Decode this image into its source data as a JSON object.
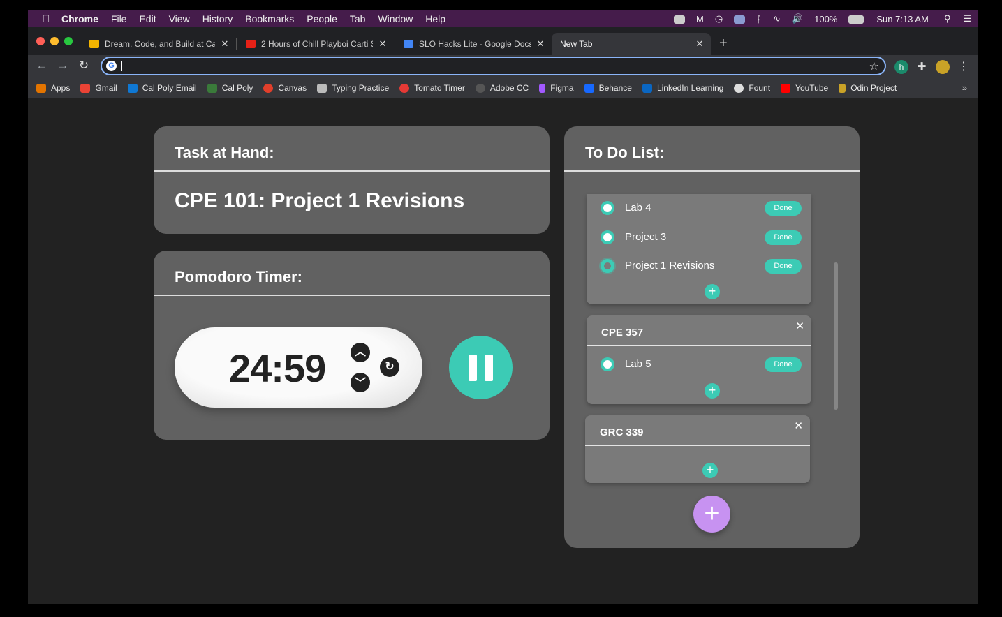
{
  "menubar": {
    "app": "Chrome",
    "items": [
      "File",
      "Edit",
      "View",
      "History",
      "Bookmarks",
      "People",
      "Tab",
      "Window",
      "Help"
    ],
    "battery": "100%",
    "clock": "Sun 7:13 AM"
  },
  "tabs": [
    {
      "title": "Dream, Code, and Build at Cal P",
      "icon_color": "#f4b400"
    },
    {
      "title": "2 Hours of Chill Playboi Carti S",
      "icon_color": "#e62117"
    },
    {
      "title": "SLO Hacks Lite - Google Docs",
      "icon_color": "#4285f4"
    },
    {
      "title": "New Tab",
      "icon_color": ""
    }
  ],
  "omnibox": {
    "value": ""
  },
  "bookmarks": [
    {
      "label": "Apps",
      "color": "#e37400"
    },
    {
      "label": "Gmail",
      "color": "#ea4335"
    },
    {
      "label": "Cal Poly Email",
      "color": "#0f78d4"
    },
    {
      "label": "Cal Poly",
      "color": "#3a7a3a"
    },
    {
      "label": "Canvas",
      "color": "#e13f2b"
    },
    {
      "label": "Typing Practice",
      "color": "#bbbbbb"
    },
    {
      "label": "Tomato Timer",
      "color": "#e53935"
    },
    {
      "label": "Adobe CC",
      "color": "#555555"
    },
    {
      "label": "Figma",
      "color": "#a259ff"
    },
    {
      "label": "Behance",
      "color": "#1769ff"
    },
    {
      "label": "LinkedIn Learning",
      "color": "#0a66c2"
    },
    {
      "label": "Fount",
      "color": "#dddddd"
    },
    {
      "label": "YouTube",
      "color": "#ff0000"
    },
    {
      "label": "Odin Project",
      "color": "#c9a227"
    }
  ],
  "bookmarks_more": "»",
  "task": {
    "heading": "Task at Hand:",
    "title": "CPE 101: Project 1 Revisions"
  },
  "timer": {
    "heading": "Pomodoro Timer:",
    "time": "24:59"
  },
  "todo": {
    "heading": "To Do List:",
    "done_label": "Done",
    "lists": [
      {
        "name": "",
        "items": [
          {
            "label": "Lab 4",
            "selected": false
          },
          {
            "label": "Project 3",
            "selected": false
          },
          {
            "label": "Project 1 Revisions",
            "selected": true
          }
        ]
      },
      {
        "name": "CPE 357",
        "items": [
          {
            "label": "Lab 5",
            "selected": false
          }
        ]
      },
      {
        "name": "GRC 339",
        "items": []
      }
    ]
  },
  "colors": {
    "accent": "#3ccbb5",
    "add_list": "#c792f1",
    "card": "#616161",
    "list_card": "#7a7a7a",
    "background": "#222222"
  }
}
